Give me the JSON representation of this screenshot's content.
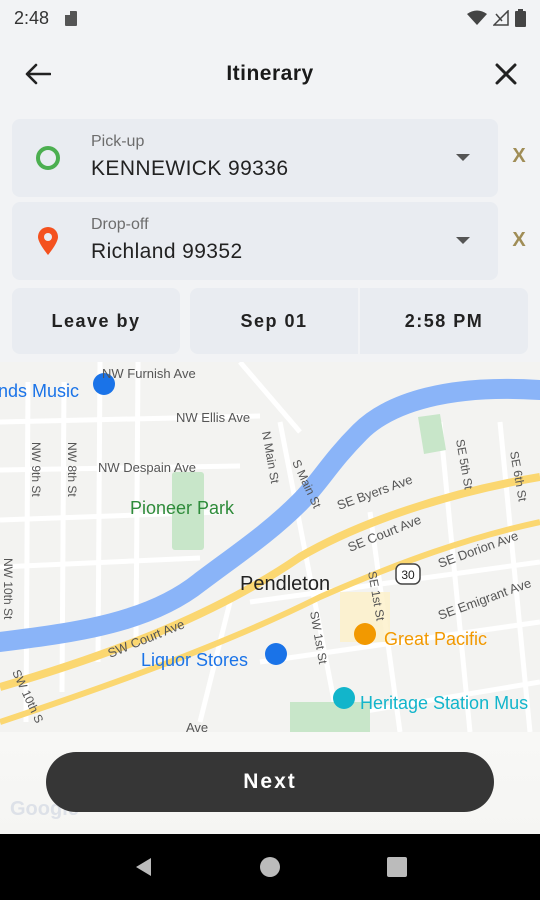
{
  "status_bar": {
    "time": "2:48",
    "icons": [
      "sd-card-icon",
      "wifi-icon",
      "signal-icon",
      "battery-icon"
    ]
  },
  "header": {
    "title": "Itinerary",
    "back_icon": "arrow-left-icon",
    "close_icon": "close-icon"
  },
  "pickup": {
    "label": "Pick-up",
    "value": "KENNEWICK 99336",
    "icon": "origin-circle-icon",
    "icon_color": "#4caf50",
    "clear": "X"
  },
  "dropoff": {
    "label": "Drop-off",
    "value": "Richland 99352",
    "icon": "location-pin-icon",
    "icon_color": "#f4511e",
    "clear": "X"
  },
  "time_options": {
    "mode": "Leave by",
    "date": "Sep 01",
    "time": "2:58 PM"
  },
  "map": {
    "labels": {
      "music": "nds Music",
      "furnish": "NW Furnish Ave",
      "ellis": "NW Ellis Ave",
      "despain": "NW Despain Ave",
      "ninth": "NW 9th St",
      "eighth": "NW 8th St",
      "tenth": "NW 10th St",
      "tenth_sw": "SW 10th S",
      "pioneer_park": "Pioneer Park",
      "n_main": "N Main St",
      "s_main": "S Main St",
      "se_byers": "SE Byers Ave",
      "se_court": "SE Court Ave",
      "se_dorion": "SE Dorion Ave",
      "se_emigrant": "SE Emigrant Ave",
      "se_5th": "SE 5th St",
      "se_6th": "SE 6th St",
      "se_1st": "SE 1st St",
      "sw_1st": "SW 1st St",
      "sw_court": "SW Court Ave",
      "pendleton": "Pendleton",
      "route_30": "30",
      "great_pacific": "Great Pacific",
      "liquor_stores": "Liquor Stores",
      "heritage": "Heritage Station Mus",
      "ave_partial": "Ave"
    },
    "colors": {
      "river": "#8ab4f8",
      "park": "#c8e6c9",
      "arterial": "#fbd771",
      "poi_blue": "#1a73e8",
      "poi_orange": "#f29900",
      "poi_teal": "#12b5cb",
      "park_text": "#2e8b3a"
    },
    "watermark": "Google"
  },
  "next_button": {
    "label": "Next"
  },
  "nav_bar": {
    "icons": [
      "back-triangle-icon",
      "home-circle-icon",
      "recents-square-icon"
    ]
  }
}
